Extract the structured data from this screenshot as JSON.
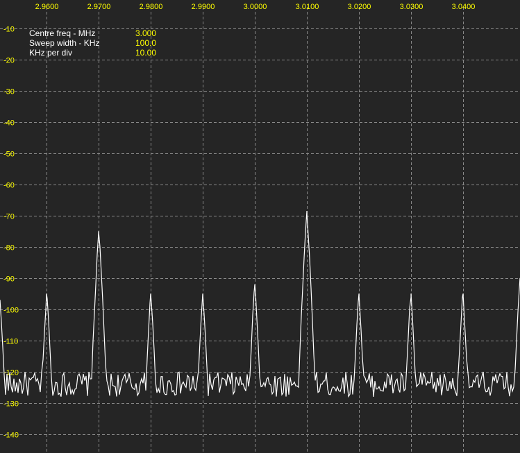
{
  "chart_data": {
    "type": "line",
    "title": "",
    "xlabel": "",
    "ylabel": "",
    "x_ticks": [
      "2.9600",
      "2.9700",
      "2.9800",
      "2.9900",
      "3.0000",
      "3.0100",
      "3.0200",
      "3.0300",
      "3.0400"
    ],
    "y_ticks": [
      "-10",
      "-20",
      "-30",
      "-40",
      "-50",
      "-60",
      "-70",
      "-80",
      "-90",
      "-100",
      "-110",
      "-120",
      "-130",
      "-140"
    ],
    "xlim": [
      2.951,
      3.051
    ],
    "ylim": [
      -146,
      -1
    ],
    "grid": true,
    "noise_floor": -124,
    "peaks": [
      {
        "x": 2.951,
        "y": -97
      },
      {
        "x": 2.96,
        "y": -95
      },
      {
        "x": 2.97,
        "y": -75
      },
      {
        "x": 2.98,
        "y": -95
      },
      {
        "x": 2.99,
        "y": -95
      },
      {
        "x": 3.0,
        "y": -92
      },
      {
        "x": 3.01,
        "y": -69
      },
      {
        "x": 3.02,
        "y": -95
      },
      {
        "x": 3.03,
        "y": -95
      },
      {
        "x": 3.04,
        "y": -95
      },
      {
        "x": 3.051,
        "y": -90
      }
    ]
  },
  "info": {
    "centre_label": "Centre freq - MHz",
    "centre_value": "3.000",
    "sweep_label": "Sweep width - KHz",
    "sweep_value": "100.0",
    "div_label": "KHz per div",
    "div_value": "10.00"
  },
  "colors": {
    "background": "#252525",
    "grid": "#8a8a8a",
    "trace": "#ffffff",
    "tick_labels": "#ffff00"
  }
}
